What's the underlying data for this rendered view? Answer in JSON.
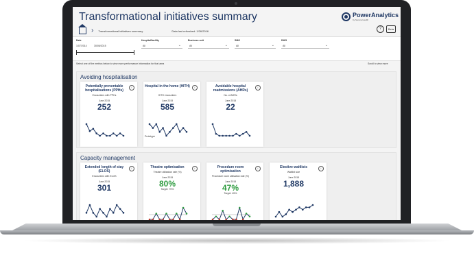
{
  "dashboard": {
    "title": "Transformational initiatives summary",
    "breadcrumb": "Transformational initiatives summary",
    "refreshed": "Data last refreshed: 1/26/2016",
    "brand_name": "PowerAnalytics",
    "brand_sub": "by Serena Health",
    "help_label": "?",
    "beta_label": "Beta"
  },
  "filters": {
    "date_label": "Date",
    "date_from": "1/07/2014",
    "date_to": "30/06/2015",
    "hospital_label": "Hospital/facility",
    "hospital_value": "All",
    "business_label": "Business unit",
    "business_value": "All",
    "smg_label": "SMG",
    "smg_value": "All",
    "dmg_label": "DMG",
    "dmg_value": "All"
  },
  "hint": "Select one of the metrics below to view more performance information for that area",
  "scroll_hint": "Scroll to view more",
  "sections": [
    {
      "title": "Avoiding hospitalisation",
      "cards": [
        {
          "title": "Potentially preventable hospitalisations (PPHs)",
          "subtitle": "Encounters with PPHs",
          "period": "June 2015",
          "value": "252",
          "series": [
            8,
            5,
            6,
            4,
            3,
            4,
            3,
            3,
            4,
            3,
            4,
            3
          ]
        },
        {
          "title": "Hospital in the home (HITH)",
          "subtitle": "HITH encounters",
          "period": "June 2015",
          "value": "585",
          "series": [
            6,
            5,
            6,
            4,
            5,
            3,
            4,
            5,
            6,
            4,
            5,
            4
          ],
          "note": "Prototype"
        },
        {
          "title": "Avoidable hospital readmissions (AHRs)",
          "subtitle": "No. of AHRs",
          "period": "June 2015",
          "value": "22",
          "series": [
            9,
            4,
            3,
            3,
            3,
            3,
            3,
            4,
            3,
            4,
            5,
            3
          ]
        }
      ]
    },
    {
      "title": "Capacity management",
      "cards": [
        {
          "title": "Extended length of stay (ELOS)",
          "subtitle": "Encounters with ELOS",
          "period": "June 2015",
          "value": "301",
          "series": [
            4,
            6,
            4,
            3,
            5,
            4,
            3,
            5,
            4,
            6,
            5,
            4
          ]
        },
        {
          "title": "Theatre optimisation",
          "subtitle": "Theatre utilisation rate (%)",
          "period": "June 2015",
          "value": "80%",
          "target": "Target: 75%",
          "value_color": "green",
          "series": [
            3,
            3,
            4,
            3,
            3,
            4,
            3,
            3,
            4,
            3,
            5,
            4
          ]
        },
        {
          "title": "Procedure room optimisation",
          "subtitle": "Procedure room utilisation rate (%)",
          "period": "June 2015",
          "value": "47%",
          "target": "Target: 45%",
          "value_color": "green",
          "series": [
            3,
            4,
            3,
            6,
            3,
            4,
            3,
            3,
            7,
            3,
            5,
            4
          ]
        },
        {
          "title": "Elective waitlists",
          "subtitle": "Waitlist size",
          "period": "June 2015",
          "value": "1,888",
          "series": [
            3,
            5,
            3,
            4,
            6,
            5,
            6,
            7,
            6,
            7,
            7,
            8
          ]
        }
      ]
    }
  ],
  "colors": {
    "primary": "#1f3864",
    "good": "#2e9b3f",
    "bad": "#c0392b"
  },
  "icons": [
    "home-icon",
    "chevron-right-icon",
    "help-icon",
    "info-icon",
    "chevron-down-icon"
  ]
}
